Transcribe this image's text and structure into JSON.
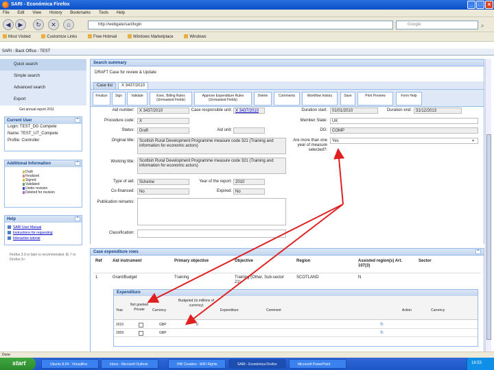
{
  "window": {
    "title": "SARI - Económica Firefox"
  },
  "menu": [
    "File",
    "Edit",
    "View",
    "History",
    "Bookmarks",
    "Tools",
    "Help"
  ],
  "nav": {
    "url": "http://webgate/sari/login",
    "search_placeholder": "Google"
  },
  "bookmarks": [
    "Most Visited",
    "Customize Links",
    "Free Hotmail",
    "Windows Marketplace",
    "Windows"
  ],
  "app": {
    "header": "SARI - Back Office - TEST"
  },
  "sidebar": {
    "nav": [
      "Quick search",
      "Simple search",
      "Advanced search",
      "Export"
    ],
    "report_label": "Get annual report 2011",
    "current_user": {
      "title": "Current User",
      "rows": [
        "Login:   TEST_DG Compete",
        "Name:    TEST_UT_Compete",
        "Profile: Controller"
      ]
    },
    "additional_info": {
      "title": "Additional Information",
      "legend": [
        "Draft",
        "Finalized",
        "Signed",
        "Validated",
        "Under revision",
        "Deleted for revision"
      ],
      "legend_colors": [
        "#c8c850",
        "#e08080",
        "#e0c040",
        "#60a060",
        "#4040c0",
        "#c060c0"
      ]
    },
    "help": {
      "title": "Help",
      "links": [
        "SARI User Manual",
        "Instructions for requesting",
        "Interactive tutorial"
      ]
    },
    "footer": "Firefox 3.0 or later is recommended. IE 7 or Firefox 3+"
  },
  "summary": {
    "header": "Search summary",
    "title": "DRAFT Case for review & Update"
  },
  "tabs": [
    "Case list",
    "X 3437/2010"
  ],
  "toolbar": [
    "Finalize",
    "Sign",
    "Validate",
    "Exec. Billing Rules (Unmasked Fields)",
    "Approve Expenditure Rules (Unmasked Fields)",
    "Delete",
    "Comments",
    "Workflow history",
    "Save",
    "Print Preview",
    "Form Help"
  ],
  "form": {
    "left": [
      {
        "label": "Aid number:",
        "value": "X 3437/2010"
      },
      {
        "label": "Procedure code:",
        "value": "X"
      },
      {
        "label": "Status:",
        "value": "Draft"
      },
      {
        "label": "Original title:",
        "value": "Scottish Rural Development Programme measure code 321 (Training and information for economic actors)"
      },
      {
        "label": "Working title:",
        "value": "Scottish Rural Development Programme measure code 321 (Training and information for economic actors)"
      },
      {
        "label": "Type of aid:",
        "value": "Scheme"
      },
      {
        "label": "Co-financed:",
        "value": "No"
      },
      {
        "label": "Publication remarks:",
        "value": ""
      },
      {
        "label": "Classification:",
        "value": ""
      }
    ],
    "middle": [
      {
        "label": "Case responsible unit:",
        "value": "X 3437/2010"
      },
      {
        "label": "Aid unit:",
        "value": ""
      },
      {
        "label": "Year of the report:",
        "value": "2010"
      },
      {
        "label": "Expired:",
        "value": "No"
      }
    ],
    "right": [
      {
        "label": "Duration start:",
        "value": "01/01/2010"
      },
      {
        "label": "Duration end:",
        "value": "31/12/2013"
      },
      {
        "label": "Member State:",
        "value": "UK"
      },
      {
        "label": "DG:",
        "value": "COMP"
      },
      {
        "label": "Are more than one year of measure selected?:",
        "value": "Yes"
      }
    ]
  },
  "expenditure": {
    "header": "Case expenditure rows",
    "columns": [
      "Ref",
      "Aid instrument",
      "Primary objective",
      "Objective",
      "Region",
      "Assisted region(s) Art. 107(3)",
      "Sector"
    ],
    "row": [
      "1",
      "Grant/Budget",
      "Training",
      "Training (Other, Sub-sector 21)",
      "SCOTLAND",
      "N",
      ""
    ],
    "sub_header": "Expenditure",
    "sub_columns": [
      "Year",
      "Not granted Private",
      "Currency",
      "Budgeted (in millions of currency)",
      "Expenditure",
      "Comment",
      "Action",
      "Currency"
    ],
    "sub_rows": [
      {
        "year": "2010",
        "currency": "GBP",
        "amount": "0"
      },
      {
        "year": "2009",
        "currency": "GBP",
        "amount": ""
      }
    ]
  },
  "statusbar": "Done",
  "taskbar": {
    "start": "start",
    "tasks": [
      "Ubuntu 8.04 - VirtualBox",
      "Inbox - Microsoft Outlook",
      "HW Creation - WiFi Rights",
      "SARI - Económica Firefox",
      "Microsoft PowerPoint"
    ],
    "clock": "16:53"
  }
}
